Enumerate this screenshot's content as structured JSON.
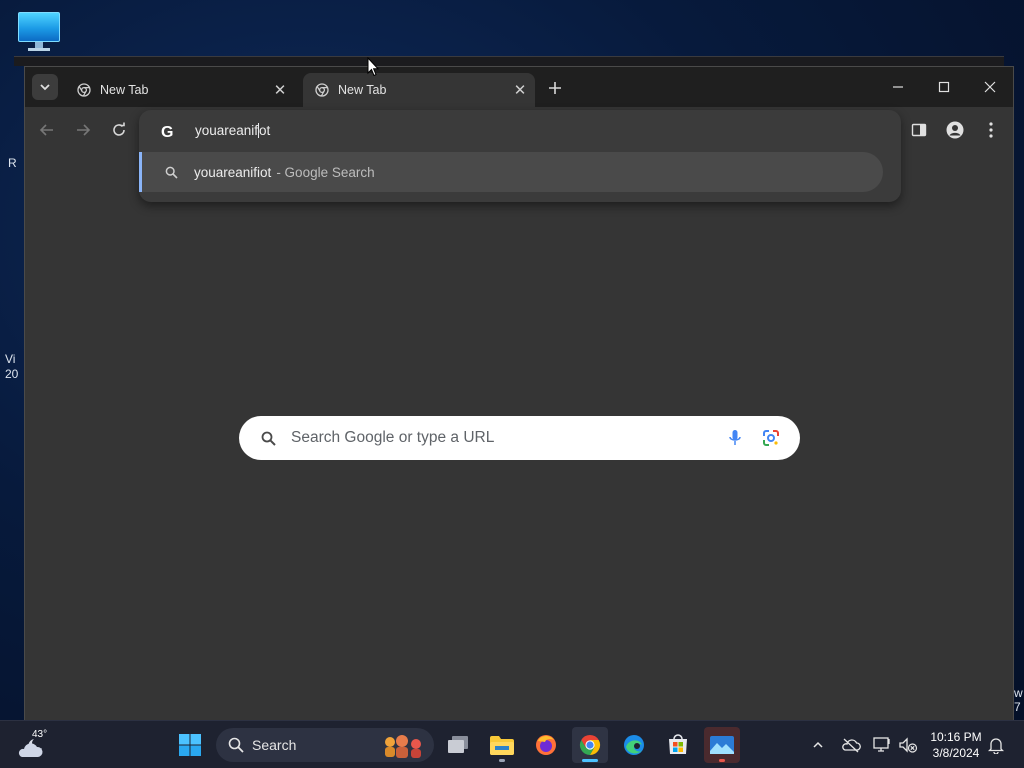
{
  "desktop": {
    "clipped_left": [
      "R",
      "Vi",
      "20"
    ],
    "clipped_right": [
      "w",
      "7"
    ]
  },
  "browser": {
    "tabs": [
      {
        "title": "New Tab",
        "active": false
      },
      {
        "title": "New Tab",
        "active": true
      }
    ],
    "omnibox": {
      "typed_before_caret": "youareanif",
      "typed_after_caret": "ot"
    },
    "suggestion": {
      "query": "youareanifiot",
      "suffix": "- Google Search"
    },
    "ntp_search": {
      "placeholder": "Search Google or type a URL"
    }
  },
  "taskbar": {
    "weather_temp": "43°",
    "search_label": "Search",
    "clock_time": "10:16 PM",
    "clock_date": "3/8/2024"
  },
  "colors": {
    "accent_blue": "#8ab4f8",
    "tab_active_bg": "#353535",
    "tabstrip_bg": "#1f1f1f",
    "taskbar_bg": "#1e2230"
  }
}
